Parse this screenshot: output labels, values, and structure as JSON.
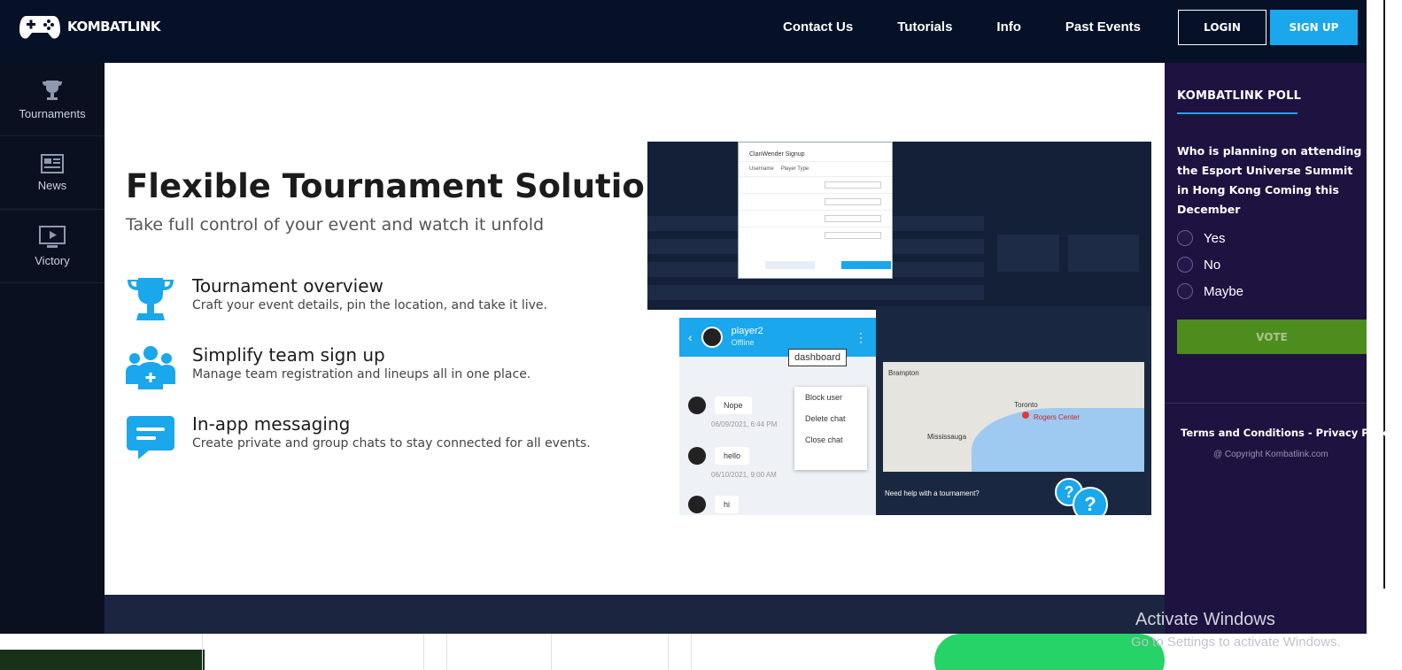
{
  "header": {
    "brand": "KOMBATLINK",
    "nav": [
      "Contact Us",
      "Tutorials",
      "Info",
      "Past Events"
    ],
    "login_label": "LOGIN",
    "signup_label": "SIGN UP"
  },
  "sidebar": {
    "items": [
      {
        "label": "Tournaments",
        "icon": "trophy-icon"
      },
      {
        "label": "News",
        "icon": "news-icon"
      },
      {
        "label": "Victory",
        "icon": "tv-icon"
      }
    ]
  },
  "main": {
    "title": "Flexible Tournament Solution",
    "subtitle": "Take full control of your event and watch it unfold",
    "features": [
      {
        "title": "Tournament overview",
        "desc": "Craft your event details, pin the location, and take it live.",
        "icon": "trophy-icon"
      },
      {
        "title": "Simplify team sign up",
        "desc": "Manage team registration and lineups all in one place.",
        "icon": "team-icon"
      },
      {
        "title": "In-app messaging",
        "desc": "Create private and group chats to stay connected for all events.",
        "icon": "chat-icon"
      }
    ]
  },
  "screenshot": {
    "modal_title": "ClanWender Signup",
    "modal_columns": [
      "Username",
      "Player Type"
    ],
    "chat_user": "player2",
    "chat_status": "Offline",
    "tooltip": "dashboard",
    "menu": [
      "Block user",
      "Delete chat",
      "Close chat"
    ],
    "messages": [
      {
        "text": "Nope",
        "time": "06/09/2021, 6:44 PM"
      },
      {
        "text": "hello",
        "time": "06/10/2021, 9:00 AM"
      },
      {
        "text": "hi",
        "time": ""
      }
    ],
    "map_labels": [
      "Toronto",
      "Rogers Center",
      "Mississauga",
      "Brampton"
    ],
    "help_text": "Need help with a tournament?"
  },
  "poll": {
    "title": "KOMBATLINK POLL",
    "question": "Who is planning on attending the Esport Universe Summit in Hong Kong Coming this December",
    "options": [
      "Yes",
      "No",
      "Maybe"
    ],
    "vote_label": "VOTE",
    "terms": "Terms and Conditions - Privacy Policy",
    "copyright": "@ Copyright Kombatlink.com"
  },
  "windows": {
    "title": "Activate Windows",
    "subtitle": "Go to Settings to activate Windows."
  },
  "colors": {
    "header_bg": "#061128",
    "accent": "#1aa7ec",
    "poll_bg": "#1e1240",
    "vote_bg": "#4d8d1e"
  }
}
